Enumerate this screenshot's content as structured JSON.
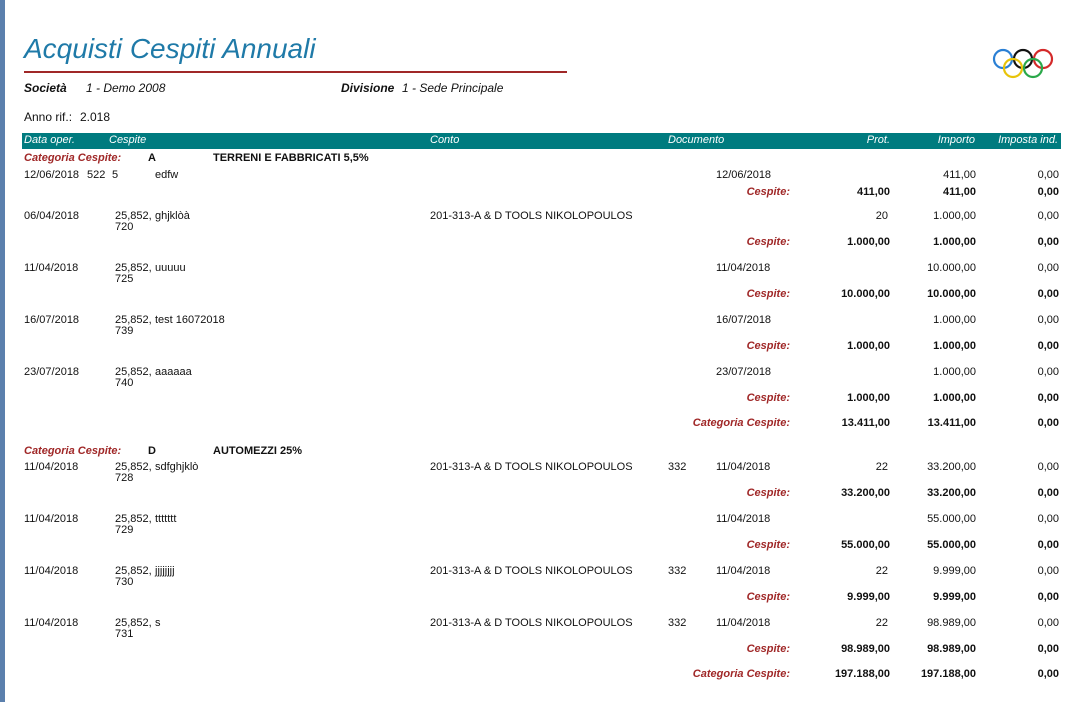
{
  "report": {
    "title": "Acquisti Cespiti Annuali",
    "societa_label": "Società",
    "societa_value": "1 - Demo 2008",
    "divisione_label": "Divisione",
    "divisione_value": "1 - Sede Principale",
    "anno_label": "Anno rif.:",
    "anno_value": "2.018",
    "accent_color": "#a02828",
    "header_color": "#007b7f",
    "title_color": "#1f7aa8",
    "logo_icon": "olympic-rings-icon"
  },
  "columns": [
    "Data oper.",
    "Cespite",
    "Conto",
    "Documento",
    "Prot.",
    "Importo",
    "Imposta ind."
  ],
  "labels": {
    "category_label": "Categoria Cespite:",
    "cespite_total_label": "Cespite:",
    "category_total_label": "Categoria Cespite:"
  },
  "categories": [
    {
      "code": "A",
      "description": "TERRENI E FABBRICATI 5,5%",
      "rows": [
        {
          "date": "12/06/2018",
          "code1": "522",
          "code2": "5",
          "name": "edfw",
          "conto": "",
          "doc_num": "",
          "doc_date": "12/06/2018",
          "prot": "",
          "importo": "411,00",
          "imposta": "0,00",
          "tot_prot": "411,00",
          "tot_importo": "411,00",
          "tot_imposta": "0,00"
        },
        {
          "date": "06/04/2018",
          "code1": "25,852,",
          "code2": "720",
          "name": "ghjklòà",
          "conto": "201-313-A & D TOOLS NIKOLOPOULOS",
          "doc_num": "",
          "doc_date": "",
          "prot": "20",
          "importo": "1.000,00",
          "imposta": "0,00",
          "tot_prot": "1.000,00",
          "tot_importo": "1.000,00",
          "tot_imposta": "0,00"
        },
        {
          "date": "11/04/2018",
          "code1": "25,852,",
          "code2": "725",
          "name": "uuuuu",
          "conto": "",
          "doc_num": "",
          "doc_date": "11/04/2018",
          "prot": "",
          "importo": "10.000,00",
          "imposta": "0,00",
          "tot_prot": "10.000,00",
          "tot_importo": "10.000,00",
          "tot_imposta": "0,00"
        },
        {
          "date": "16/07/2018",
          "code1": "25,852,",
          "code2": "739",
          "name": "test 16072018",
          "conto": "",
          "doc_num": "",
          "doc_date": "16/07/2018",
          "prot": "",
          "importo": "1.000,00",
          "imposta": "0,00",
          "tot_prot": "1.000,00",
          "tot_importo": "1.000,00",
          "tot_imposta": "0,00"
        },
        {
          "date": "23/07/2018",
          "code1": "25,852,",
          "code2": "740",
          "name": "aaaaaa",
          "conto": "",
          "doc_num": "",
          "doc_date": "23/07/2018",
          "prot": "",
          "importo": "1.000,00",
          "imposta": "0,00",
          "tot_prot": "1.000,00",
          "tot_importo": "1.000,00",
          "tot_imposta": "0,00"
        }
      ],
      "total": {
        "prot": "13.411,00",
        "importo": "13.411,00",
        "imposta": "0,00"
      }
    },
    {
      "code": "D",
      "description": "AUTOMEZZI 25%",
      "rows": [
        {
          "date": "11/04/2018",
          "code1": "25,852,",
          "code2": "728",
          "name": "sdfghjklò",
          "conto": "201-313-A & D TOOLS NIKOLOPOULOS",
          "doc_num": "332",
          "doc_date": "11/04/2018",
          "prot": "22",
          "importo": "33.200,00",
          "imposta": "0,00",
          "tot_prot": "33.200,00",
          "tot_importo": "33.200,00",
          "tot_imposta": "0,00"
        },
        {
          "date": "11/04/2018",
          "code1": "25,852,",
          "code2": "729",
          "name": "ttttttt",
          "conto": "",
          "doc_num": "",
          "doc_date": "11/04/2018",
          "prot": "",
          "importo": "55.000,00",
          "imposta": "0,00",
          "tot_prot": "55.000,00",
          "tot_importo": "55.000,00",
          "tot_imposta": "0,00"
        },
        {
          "date": "11/04/2018",
          "code1": "25,852,",
          "code2": "730",
          "name": "jjjjjjjj",
          "conto": "201-313-A & D TOOLS NIKOLOPOULOS",
          "doc_num": "332",
          "doc_date": "11/04/2018",
          "prot": "22",
          "importo": "9.999,00",
          "imposta": "0,00",
          "tot_prot": "9.999,00",
          "tot_importo": "9.999,00",
          "tot_imposta": "0,00"
        },
        {
          "date": "11/04/2018",
          "code1": "25,852,",
          "code2": "731",
          "name": "s",
          "conto": "201-313-A & D TOOLS NIKOLOPOULOS",
          "doc_num": "332",
          "doc_date": "11/04/2018",
          "prot": "22",
          "importo": "98.989,00",
          "imposta": "0,00",
          "tot_prot": "98.989,00",
          "tot_importo": "98.989,00",
          "tot_imposta": "0,00"
        }
      ],
      "total": {
        "prot": "197.188,00",
        "importo": "197.188,00",
        "imposta": "0,00"
      }
    }
  ]
}
